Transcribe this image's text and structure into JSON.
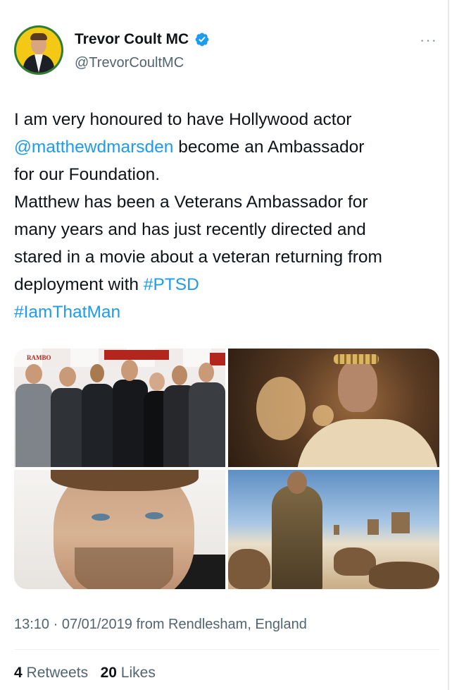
{
  "author": {
    "name": "Trevor Coult MC",
    "handle": "@TrevorCoultMC",
    "verified": true,
    "avatar_icon": "profile-photo"
  },
  "more_label": "···",
  "tweet": {
    "lines": [
      [
        {
          "t": "I am very honoured to have Hollywood actor",
          "link": false
        }
      ],
      [
        {
          "t": "@matthewdmarsden",
          "link": true
        },
        {
          "t": " become an Ambassador",
          "link": false
        }
      ],
      [
        {
          "t": "for our Foundation.",
          "link": false
        }
      ],
      [
        {
          "t": "Matthew has been a Veterans Ambassador for",
          "link": false
        }
      ],
      [
        {
          "t": "many years and has just recently directed and",
          "link": false
        }
      ],
      [
        {
          "t": "stared in a movie about a veteran returning from",
          "link": false
        }
      ],
      [
        {
          "t": "deployment with ",
          "link": false
        },
        {
          "t": "#PTSD",
          "link": true
        }
      ],
      [
        {
          "t": "#IamThatMan",
          "link": true
        }
      ]
    ]
  },
  "media": {
    "tile1_banner_text": "RAMBO"
  },
  "footer": {
    "timestamp": "13:10 · 07/01/2019 from Rendlesham, England",
    "retweets_count": "4",
    "retweets_label": "Retweets",
    "likes_count": "20",
    "likes_label": "Likes"
  },
  "colors": {
    "link": "#1d9bf0",
    "muted": "#536471",
    "text": "#0f1419",
    "verified": "#1d9bf0"
  }
}
